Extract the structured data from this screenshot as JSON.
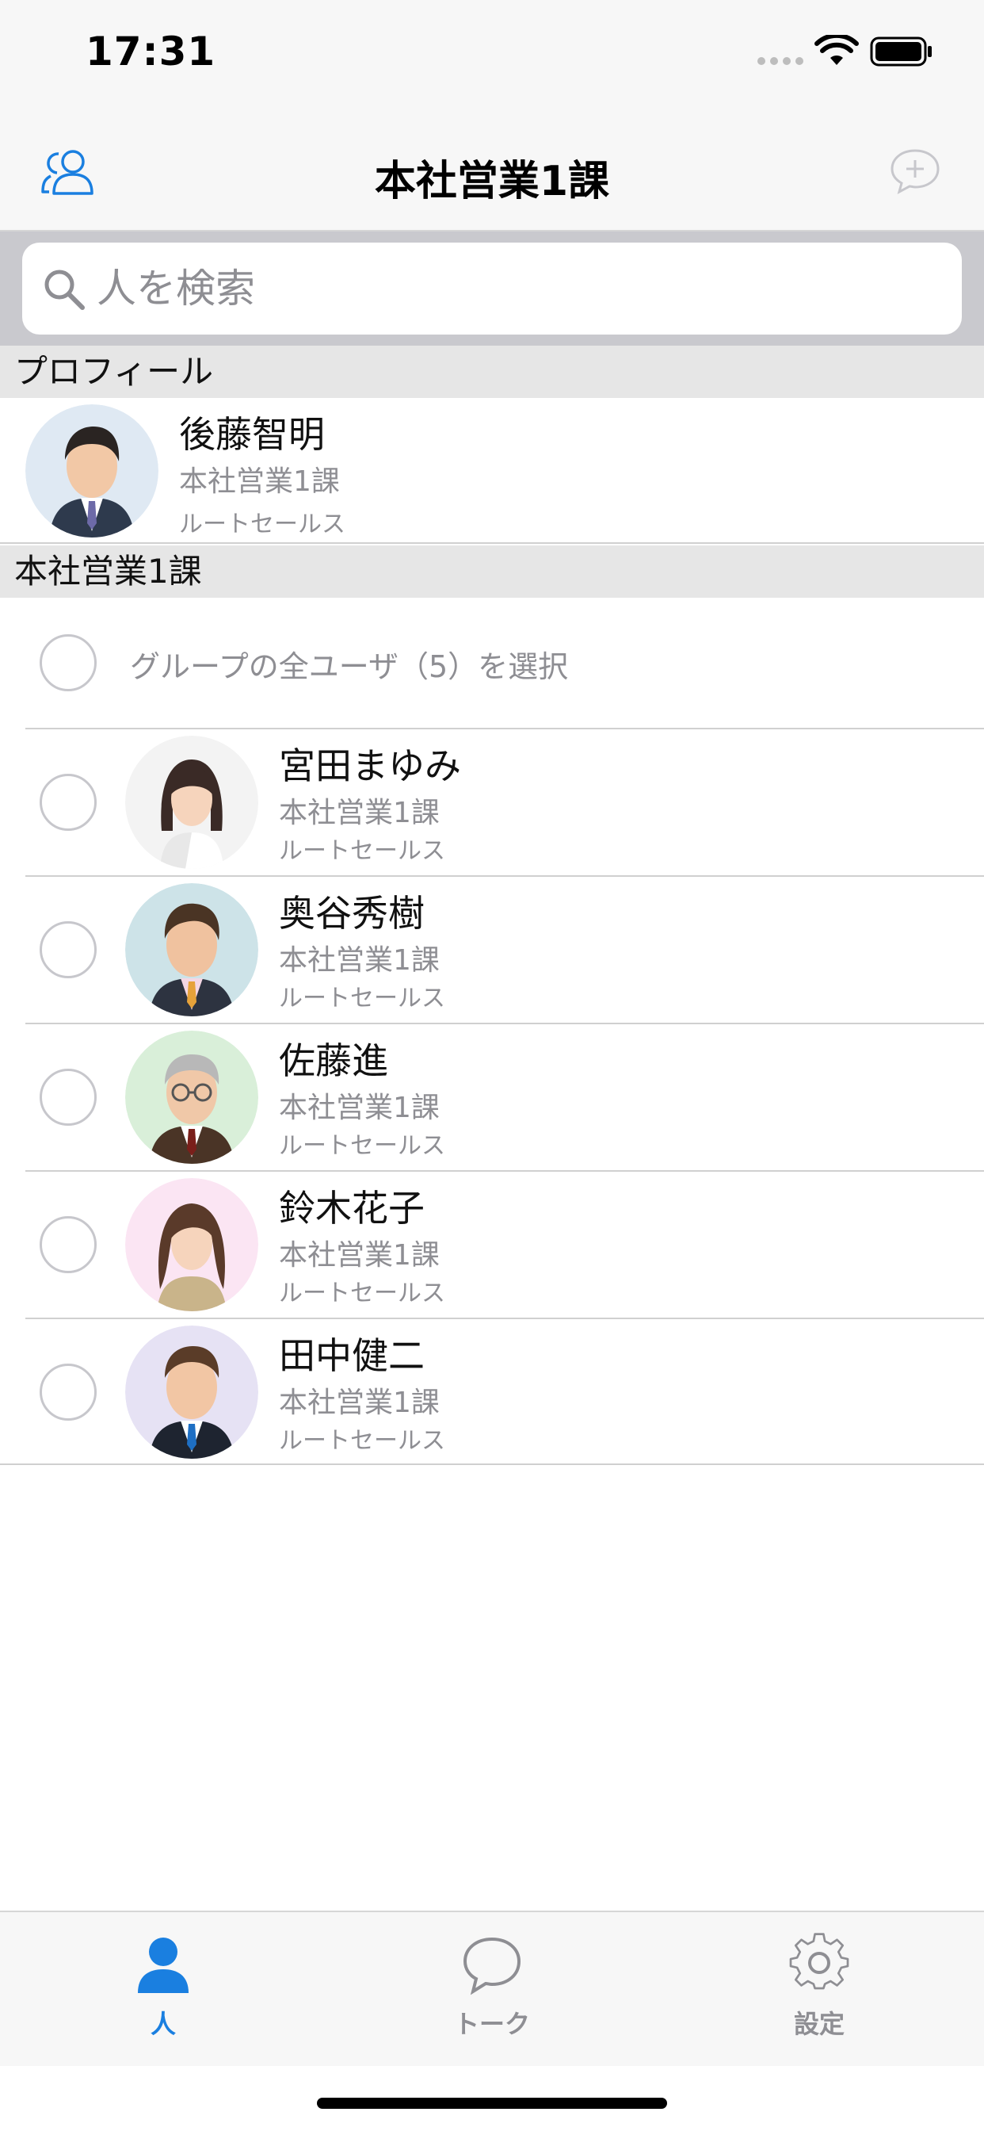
{
  "status_bar": {
    "time": "17:31"
  },
  "nav": {
    "title": "本社営業1課",
    "left_icon": "people-icon",
    "right_icon": "chat-plus-icon"
  },
  "search": {
    "placeholder": "人を検索",
    "value": ""
  },
  "profile_section": {
    "header": "プロフィール",
    "user": {
      "name": "後藤智明",
      "dept": "本社営業1課",
      "role": "ルートセールス"
    }
  },
  "group_section": {
    "header": "本社営業1課",
    "select_all_label": "グループの全ユーザ（5）を選択",
    "members": [
      {
        "name": "宮田まゆみ",
        "dept": "本社営業1課",
        "role": "ルートセールス"
      },
      {
        "name": "奥谷秀樹",
        "dept": "本社営業1課",
        "role": "ルートセールス"
      },
      {
        "name": "佐藤進",
        "dept": "本社営業1課",
        "role": "ルートセールス"
      },
      {
        "name": "鈴木花子",
        "dept": "本社営業1課",
        "role": "ルートセールス"
      },
      {
        "name": "田中健二",
        "dept": "本社営業1課",
        "role": "ルートセールス"
      }
    ]
  },
  "tabs": [
    {
      "label": "人",
      "icon": "person-icon",
      "active": true
    },
    {
      "label": "トーク",
      "icon": "speech-bubble-icon",
      "active": false
    },
    {
      "label": "設定",
      "icon": "gear-icon",
      "active": false
    }
  ],
  "colors": {
    "accent": "#1a7fe0",
    "inactive": "#8e8e93"
  }
}
